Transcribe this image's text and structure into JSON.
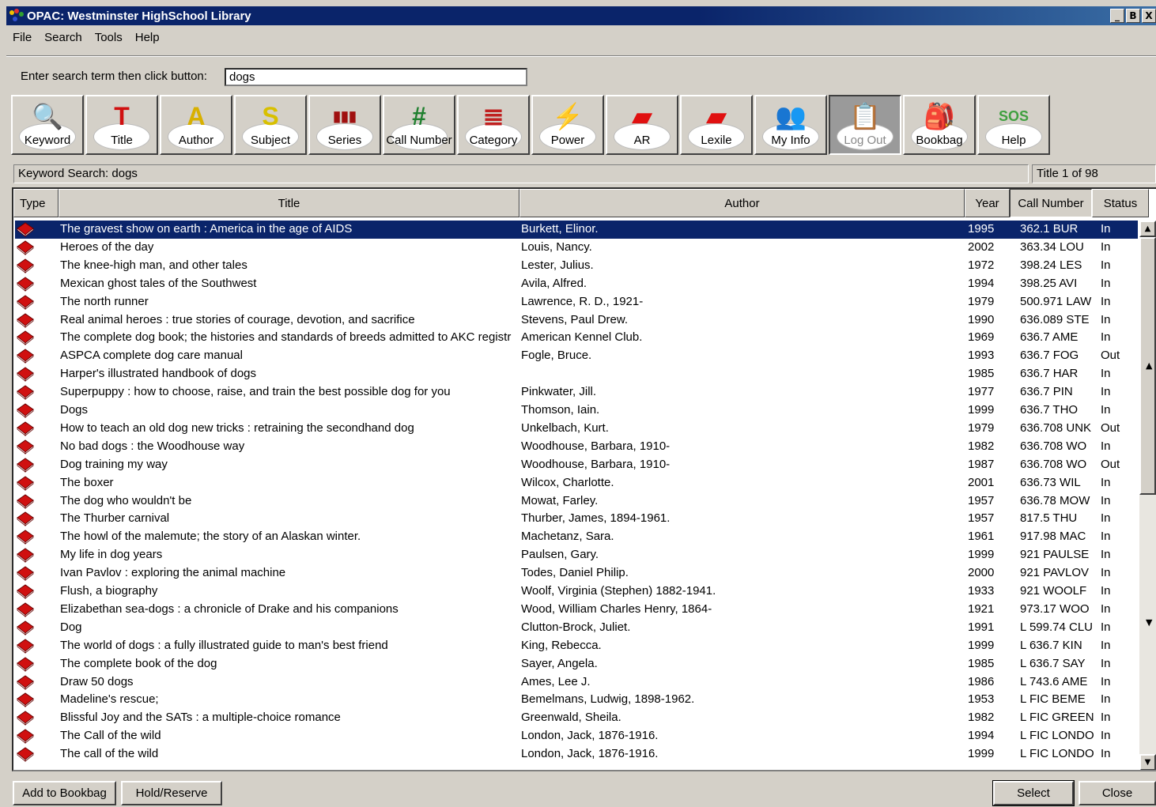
{
  "window": {
    "title": "OPAC: Westminster HighSchool Library",
    "controls": [
      "_",
      "B",
      "X"
    ]
  },
  "menu": [
    "File",
    "Search",
    "Tools",
    "Help"
  ],
  "search": {
    "label": "Enter search term then click button:",
    "value": "dogs"
  },
  "toolbar": [
    {
      "label": "Keyword",
      "icon": "magnifier-globe-icon",
      "glyph": "🔍",
      "color": "#7a4fa0"
    },
    {
      "label": "Title",
      "icon": "title-book-icon",
      "glyph": "T",
      "color": "#d01010"
    },
    {
      "label": "Author",
      "icon": "author-pencil-icon",
      "glyph": "A",
      "color": "#d8b000"
    },
    {
      "label": "Subject",
      "icon": "subject-globe-icon",
      "glyph": "S",
      "color": "#d8c000"
    },
    {
      "label": "Series",
      "icon": "series-books-icon",
      "glyph": "▮▮▮",
      "color": "#a01010"
    },
    {
      "label": "Call Number",
      "icon": "call-number-icon",
      "glyph": "#",
      "color": "#208030"
    },
    {
      "label": "Category",
      "icon": "category-books-icon",
      "glyph": "≣",
      "color": "#c02020"
    },
    {
      "label": "Power",
      "icon": "power-search-icon",
      "glyph": "⚡",
      "color": "#4040a0"
    },
    {
      "label": "AR",
      "icon": "ar-reader-icon",
      "glyph": "▰",
      "color": "#e01010"
    },
    {
      "label": "Lexile",
      "icon": "lexile-reader-icon",
      "glyph": "▰",
      "color": "#e01010"
    },
    {
      "label": "My Info",
      "icon": "my-info-people-icon",
      "glyph": "👥",
      "color": "#2030c0"
    },
    {
      "label": "Log Out",
      "icon": "log-out-clipboard-icon",
      "glyph": "📋",
      "color": "#888888",
      "pressed": true
    },
    {
      "label": "Bookbag",
      "icon": "bookbag-icon",
      "glyph": "🎒",
      "color": "#508050"
    },
    {
      "label": "Help",
      "icon": "help-sos-icon",
      "glyph": "SOS",
      "color": "#40a040"
    }
  ],
  "status": {
    "search_text": "Keyword Search: dogs",
    "count": "Title 1 of 98"
  },
  "columns": [
    "Type",
    "Title",
    "Author",
    "Year",
    "Call Number",
    "Status"
  ],
  "rows": [
    {
      "title": "The gravest show on earth : America in the age of AIDS",
      "author": "Burkett, Elinor.",
      "year": "1995",
      "call": "362.1 BUR",
      "status": "In"
    },
    {
      "title": "Heroes of the day",
      "author": "Louis, Nancy.",
      "year": "2002",
      "call": "363.34 LOU",
      "status": "In"
    },
    {
      "title": "The knee-high man, and other tales",
      "author": "Lester, Julius.",
      "year": "1972",
      "call": "398.24 LES",
      "status": "In"
    },
    {
      "title": "Mexican ghost tales of the Southwest",
      "author": "Avila, Alfred.",
      "year": "1994",
      "call": "398.25 AVI",
      "status": "In"
    },
    {
      "title": "The north runner",
      "author": "Lawrence, R. D., 1921-",
      "year": "1979",
      "call": "500.971 LAW",
      "status": "In"
    },
    {
      "title": "Real animal heroes : true stories of courage, devotion, and sacrifice",
      "author": "Stevens, Paul Drew.",
      "year": "1990",
      "call": "636.089 STE",
      "status": "In"
    },
    {
      "title": "The complete dog book; the histories and standards of breeds admitted to AKC registr",
      "author": "American Kennel Club.",
      "year": "1969",
      "call": "636.7 AME",
      "status": "In"
    },
    {
      "title": "ASPCA complete dog care manual",
      "author": "Fogle, Bruce.",
      "year": "1993",
      "call": "636.7 FOG",
      "status": "Out"
    },
    {
      "title": "Harper's illustrated handbook of dogs",
      "author": "",
      "year": "1985",
      "call": "636.7 HAR",
      "status": "In"
    },
    {
      "title": "Superpuppy : how to choose, raise, and train the best possible dog for you",
      "author": "Pinkwater, Jill.",
      "year": "1977",
      "call": "636.7 PIN",
      "status": "In"
    },
    {
      "title": "Dogs",
      "author": "Thomson, Iain.",
      "year": "1999",
      "call": "636.7 THO",
      "status": "In"
    },
    {
      "title": "How to teach an old dog new tricks : retraining the secondhand dog",
      "author": "Unkelbach, Kurt.",
      "year": "1979",
      "call": "636.708 UNK",
      "status": "Out"
    },
    {
      "title": "No bad dogs : the Woodhouse way",
      "author": "Woodhouse, Barbara, 1910-",
      "year": "1982",
      "call": "636.708 WO",
      "status": "In"
    },
    {
      "title": "Dog training my way",
      "author": "Woodhouse, Barbara, 1910-",
      "year": "1987",
      "call": "636.708 WO",
      "status": "Out"
    },
    {
      "title": "The boxer",
      "author": "Wilcox, Charlotte.",
      "year": "2001",
      "call": "636.73 WIL",
      "status": "In"
    },
    {
      "title": "The dog who wouldn't be",
      "author": "Mowat, Farley.",
      "year": "1957",
      "call": "636.78 MOW",
      "status": "In"
    },
    {
      "title": "The Thurber carnival",
      "author": "Thurber, James, 1894-1961.",
      "year": "1957",
      "call": "817.5 THU",
      "status": "In"
    },
    {
      "title": "The howl of the malemute; the story of an Alaskan winter.",
      "author": "Machetanz, Sara.",
      "year": "1961",
      "call": "917.98 MAC",
      "status": "In"
    },
    {
      "title": "My life in dog years",
      "author": "Paulsen, Gary.",
      "year": "1999",
      "call": "921 PAULSE",
      "status": "In"
    },
    {
      "title": "Ivan Pavlov : exploring the animal machine",
      "author": "Todes, Daniel Philip.",
      "year": "2000",
      "call": "921 PAVLOV",
      "status": "In"
    },
    {
      "title": "Flush, a biography",
      "author": "Woolf, Virginia (Stephen) 1882-1941.",
      "year": "1933",
      "call": "921 WOOLF",
      "status": "In"
    },
    {
      "title": "Elizabethan sea-dogs : a chronicle of Drake and his companions",
      "author": "Wood, William Charles Henry, 1864-",
      "year": "1921",
      "call": "973.17 WOO",
      "status": "In"
    },
    {
      "title": "Dog",
      "author": "Clutton-Brock, Juliet.",
      "year": "1991",
      "call": "L 599.74 CLU",
      "status": "In"
    },
    {
      "title": "The world of dogs : a fully illustrated guide to man's best friend",
      "author": "King, Rebecca.",
      "year": "1999",
      "call": "L 636.7 KIN",
      "status": "In"
    },
    {
      "title": "The complete book of the dog",
      "author": "Sayer, Angela.",
      "year": "1985",
      "call": "L 636.7 SAY",
      "status": "In"
    },
    {
      "title": "Draw 50 dogs",
      "author": "Ames, Lee J.",
      "year": "1986",
      "call": "L 743.6 AME",
      "status": "In"
    },
    {
      "title": "Madeline's rescue;",
      "author": "Bemelmans, Ludwig, 1898-1962.",
      "year": "1953",
      "call": "L FIC  BEME",
      "status": "In"
    },
    {
      "title": "Blissful Joy and the SATs : a multiple-choice romance",
      "author": "Greenwald, Sheila.",
      "year": "1982",
      "call": "L FIC GREEN",
      "status": "In"
    },
    {
      "title": "The Call of the wild",
      "author": "London, Jack, 1876-1916.",
      "year": "1994",
      "call": "L FIC LONDO",
      "status": "In"
    },
    {
      "title": "The call of the wild",
      "author": "London, Jack, 1876-1916.",
      "year": "1999",
      "call": "L FIC LONDO",
      "status": "In"
    }
  ],
  "buttons": {
    "add_to_bookbag": "Add to Bookbag",
    "hold_reserve": "Hold/Reserve",
    "select": "Select",
    "close": "Close"
  },
  "colors": {
    "titlebar": "#0a246a",
    "selection": "#0a246a",
    "face": "#d4d0c8",
    "book_red": "#d01010"
  }
}
